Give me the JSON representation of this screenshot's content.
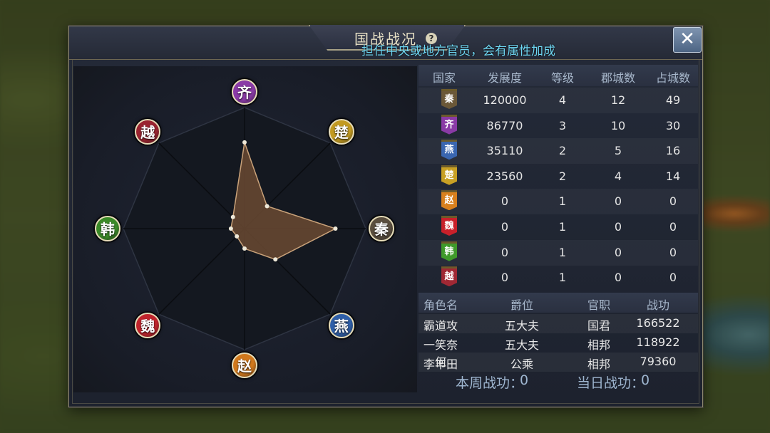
{
  "dialog": {
    "title": "国战战况",
    "help_icon": "?",
    "hint": "担任中央或地方官员，会有属性加成",
    "close_icon": "close-x"
  },
  "radar": {
    "nodes": [
      {
        "label": "齐",
        "color": "#8a3aa6"
      },
      {
        "label": "楚",
        "color": "#c29a22"
      },
      {
        "label": "秦",
        "color": "#5a4e3e"
      },
      {
        "label": "燕",
        "color": "#2f5fa8"
      },
      {
        "label": "赵",
        "color": "#d0781c"
      },
      {
        "label": "魏",
        "color": "#c0242c"
      },
      {
        "label": "韩",
        "color": "#3b8a28"
      },
      {
        "label": "越",
        "color": "#9a2430"
      }
    ],
    "values": [
      0.95,
      0.35,
      1.0,
      0.48,
      0.22,
      0.12,
      0.15,
      0.18
    ],
    "fill_color": "#6a4a32",
    "stroke_color": "#c9a27a"
  },
  "nation_table": {
    "headers": [
      "国家",
      "发展度",
      "等级",
      "郡城数",
      "占城数"
    ],
    "rows": [
      {
        "nation": "秦",
        "flag_color": "#6b5838",
        "dev": "120000",
        "level": "4",
        "cities": "12",
        "occupied": "49"
      },
      {
        "nation": "齐",
        "flag_color": "#8a3aa6",
        "dev": "86770",
        "level": "3",
        "cities": "10",
        "occupied": "30"
      },
      {
        "nation": "燕",
        "flag_color": "#3a66b0",
        "dev": "35110",
        "level": "2",
        "cities": "5",
        "occupied": "16"
      },
      {
        "nation": "楚",
        "flag_color": "#c8a024",
        "dev": "23560",
        "level": "2",
        "cities": "4",
        "occupied": "14"
      },
      {
        "nation": "赵",
        "flag_color": "#d8801e",
        "dev": "0",
        "level": "1",
        "cities": "0",
        "occupied": "0"
      },
      {
        "nation": "魏",
        "flag_color": "#c8202a",
        "dev": "0",
        "level": "1",
        "cities": "0",
        "occupied": "0"
      },
      {
        "nation": "韩",
        "flag_color": "#3f9a2a",
        "dev": "0",
        "level": "1",
        "cities": "0",
        "occupied": "0"
      },
      {
        "nation": "越",
        "flag_color": "#a02834",
        "dev": "0",
        "level": "1",
        "cities": "0",
        "occupied": "0"
      }
    ]
  },
  "player_table": {
    "headers": [
      "角色名",
      "爵位",
      "官职",
      "战功"
    ],
    "rows": [
      {
        "name": "霸道攻",
        "rank": "五大夫",
        "office": "国君",
        "merit": "166522"
      },
      {
        "name": "一笑奈何",
        "rank": "五大夫",
        "office": "相邦",
        "merit": "118922"
      },
      {
        "name": "李丰田",
        "rank": "公乘",
        "office": "相邦",
        "merit": "79360"
      }
    ]
  },
  "footer": {
    "weekly_label": "本周战功：",
    "weekly_value": "0",
    "daily_label": "当日战功：",
    "daily_value": "0"
  }
}
